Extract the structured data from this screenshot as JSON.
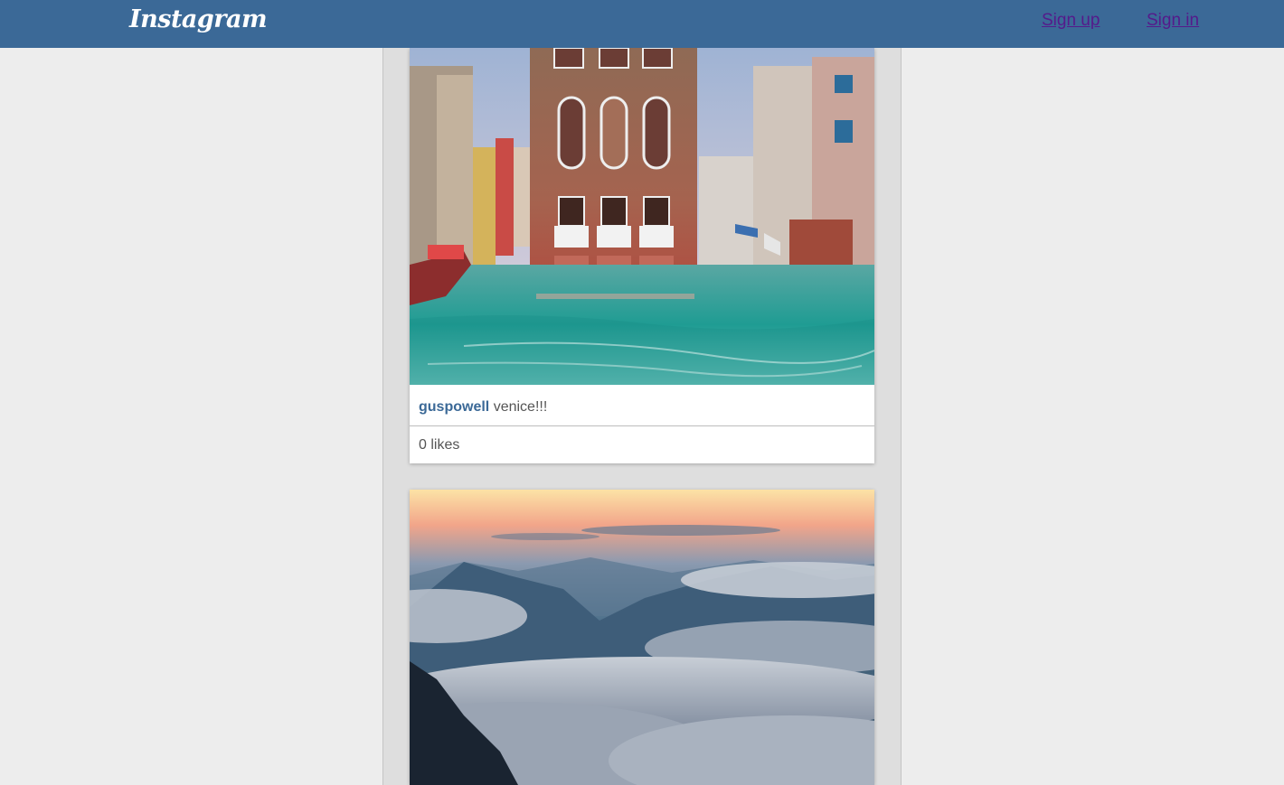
{
  "header": {
    "logo": "Instagram",
    "signup_label": "Sign up",
    "signin_label": "Sign in"
  },
  "posts": [
    {
      "username": "guspowell",
      "caption": "venice!!!",
      "likes": "0 likes",
      "photo_subject": "venice-canal-photo"
    },
    {
      "photo_subject": "mountains-above-clouds-photo"
    }
  ],
  "colors": {
    "header_bg": "#3b6997",
    "page_bg": "#ededed",
    "feed_bg": "#dedede",
    "username": "#3b6997",
    "visited_link": "#551a8b"
  }
}
